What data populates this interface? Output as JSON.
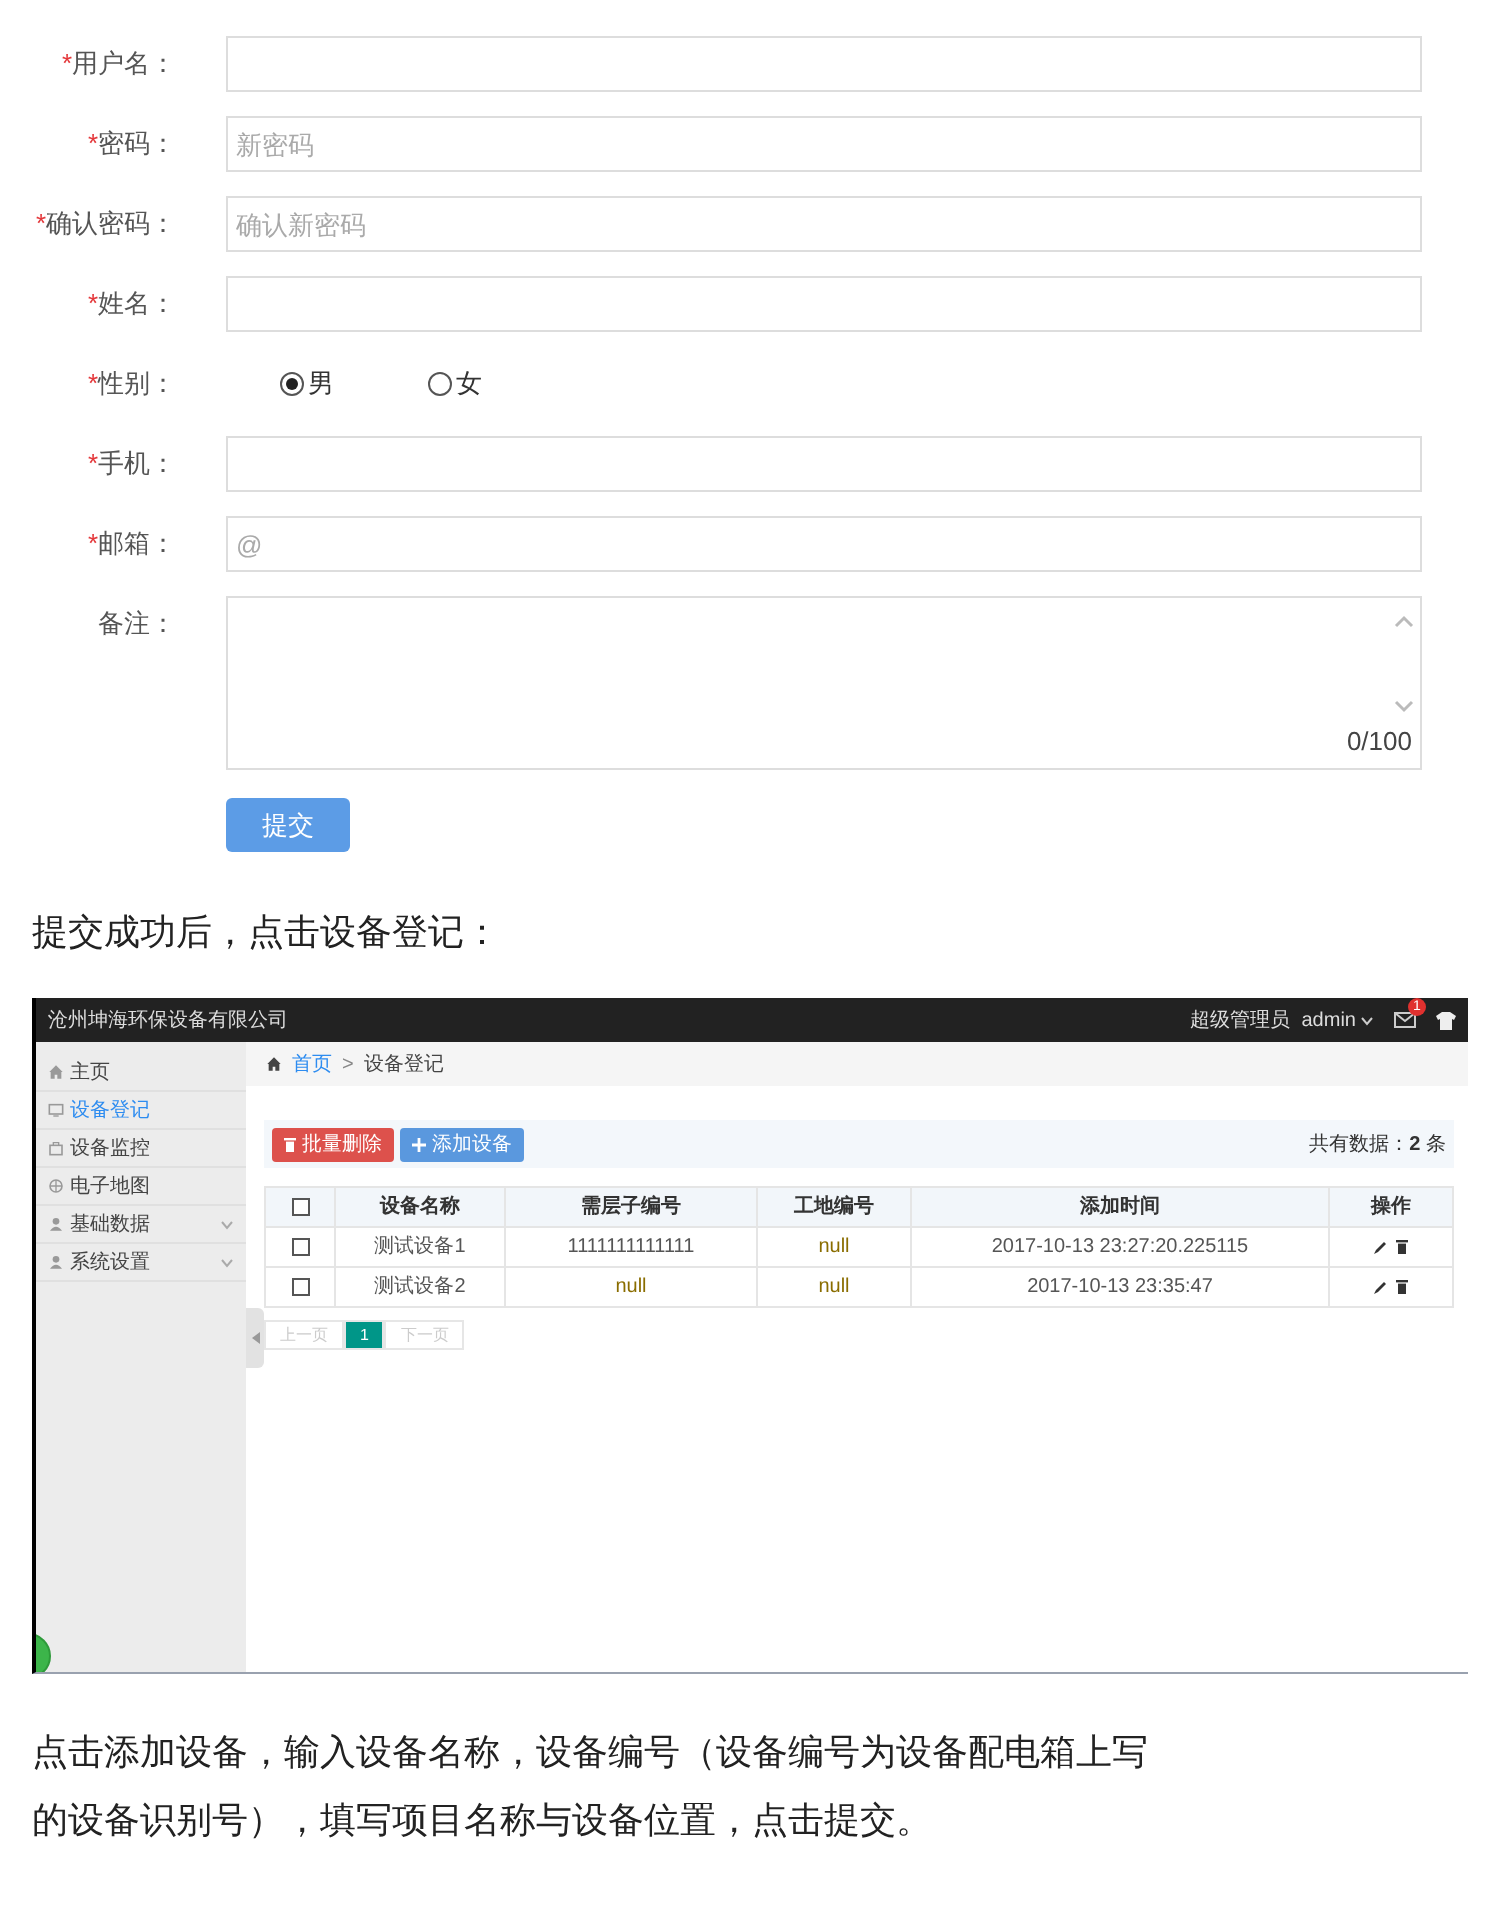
{
  "form": {
    "fields": [
      {
        "kind": "input",
        "required_mark": "*",
        "label": "用户名："
      },
      {
        "kind": "input",
        "required_mark": "*",
        "label": "密码：",
        "placeholder": "新密码"
      },
      {
        "kind": "input",
        "required_mark": "*",
        "label": "确认密码：",
        "placeholder": "确认新密码"
      },
      {
        "kind": "input",
        "required_mark": "*",
        "label": "姓名："
      },
      {
        "kind": "radio",
        "required_mark": "*",
        "label": "性别：",
        "options": [
          {
            "label": "男",
            "selected": true
          },
          {
            "label": "女",
            "selected": false
          }
        ]
      },
      {
        "kind": "input",
        "required_mark": "*",
        "label": "手机："
      },
      {
        "kind": "input",
        "required_mark": "*",
        "label": "邮箱：",
        "placeholder": "@"
      },
      {
        "kind": "textarea",
        "label": "备注：",
        "counter": "0/100"
      }
    ],
    "submit": "提交"
  },
  "paragraph_1": "提交成功后，点击设备登记：",
  "app": {
    "title": "沧州坤海环保设备有限公司",
    "user_role": "超级管理员",
    "user_name": "admin",
    "mail_badge": "1",
    "sidebar": [
      {
        "label": "主页",
        "selected": false,
        "expandable": false
      },
      {
        "label": "设备登记",
        "selected": true,
        "expandable": false
      },
      {
        "label": "设备监控",
        "selected": false,
        "expandable": false
      },
      {
        "label": "电子地图",
        "selected": false,
        "expandable": false
      },
      {
        "label": "基础数据",
        "selected": false,
        "expandable": true
      },
      {
        "label": "系统设置",
        "selected": false,
        "expandable": true
      }
    ],
    "breadcrumb": [
      "首页",
      "设备登记"
    ],
    "breadcrumb_separator": ">",
    "select_all_checked": false,
    "buttons": [
      {
        "label": "批量删除",
        "kind": "danger"
      },
      {
        "label": "添加设备",
        "kind": "primary"
      }
    ],
    "total": "共有数据：**2** 条",
    "columns": [
      "设备名称",
      "需层子编号",
      "工地编号",
      "添加时间",
      "操作"
    ],
    "rows": [
      {
        "checked": false,
        "cells": [
          "测试设备1",
          "1111111111111",
          "null",
          "2017-10-13 23:27:20.225115"
        ]
      },
      {
        "checked": false,
        "cells": [
          "测试设备2",
          "null",
          "null",
          "2017-10-13 23:35:47"
        ]
      }
    ],
    "pagination": [
      {
        "label": "上一页",
        "selected": false,
        "disabled": true
      },
      {
        "label": "1",
        "selected": true,
        "disabled": false
      },
      {
        "label": "下一页",
        "selected": false,
        "disabled": true
      }
    ]
  },
  "paragraph_2": {
    "lines": [
      "点击添加设备，输入设备名称，设备编号（设备编号为设备配电箱上写",
      "的设备识别号），填写项目名称与设备位置，点击提交。"
    ]
  }
}
